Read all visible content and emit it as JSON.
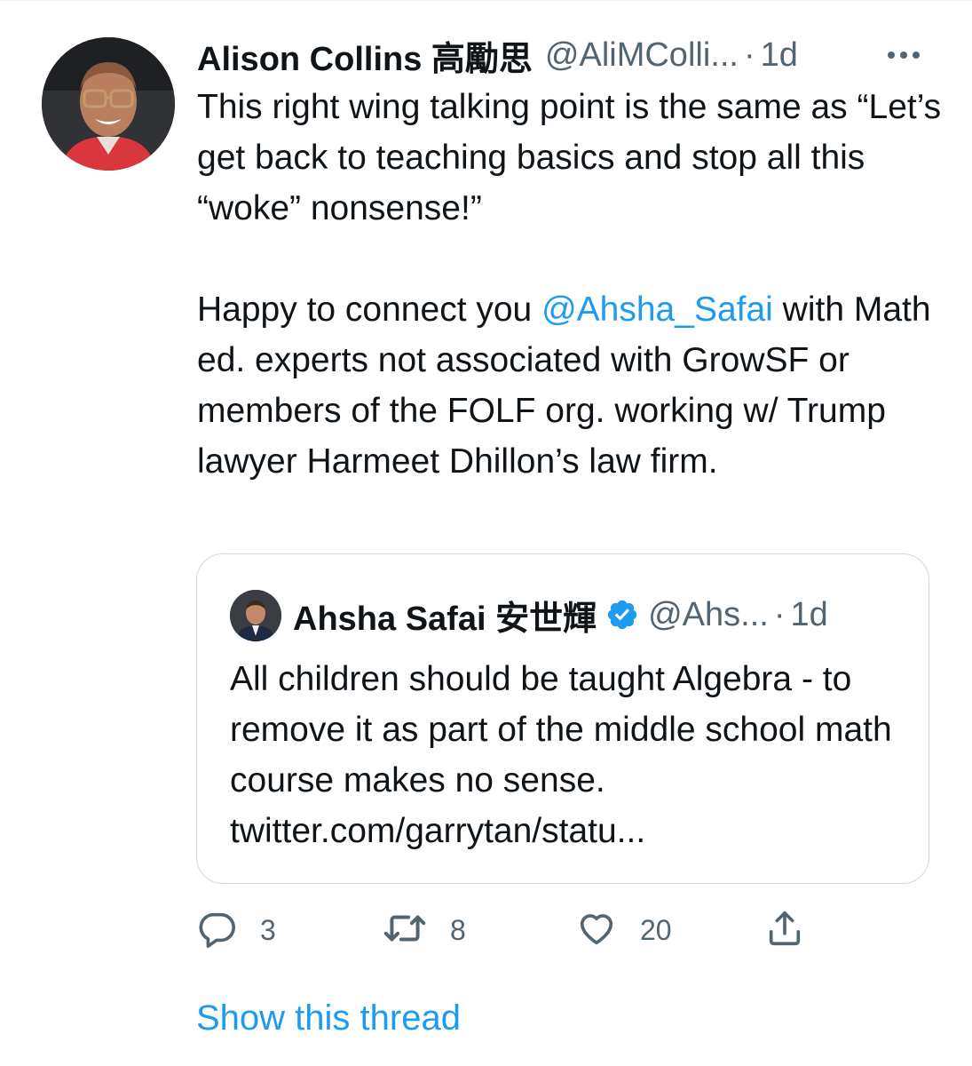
{
  "tweet": {
    "author": {
      "display_name": "Alison Collins 高勵思",
      "handle": "@AliMColli...",
      "separator": "·",
      "time": "1d"
    },
    "body": {
      "para1": "This right wing talking point is the same as “Let’s get back to teaching basics and stop all this “woke” nonsense!”",
      "para2_pre": "Happy to connect you ",
      "para2_mention": "@Ahsha_Safai",
      "para2_post": " with Math ed. experts not associated with GrowSF or members of the FOLF org. working w/ Trump lawyer Harmeet Dhillon’s law firm."
    },
    "quote": {
      "display_name": "Ahsha Safai 安世輝",
      "handle": "@Ahs...",
      "separator": "·",
      "time": "1d",
      "text": "All children should be taught Algebra - to remove it as part of the middle school math course makes no sense. twitter.com/garrytan/statu..."
    },
    "actions": {
      "replies": "3",
      "retweets": "8",
      "likes": "20"
    },
    "show_thread_label": "Show this thread"
  },
  "icons": {
    "more": "more-horizontal-icon",
    "reply": "reply-icon",
    "retweet": "retweet-icon",
    "like": "heart-icon",
    "share": "share-icon",
    "verified": "verified-badge-icon"
  },
  "colors": {
    "text": "#0f1419",
    "secondary": "#536471",
    "accent": "#1d9bf0",
    "border": "#cfd9de"
  }
}
